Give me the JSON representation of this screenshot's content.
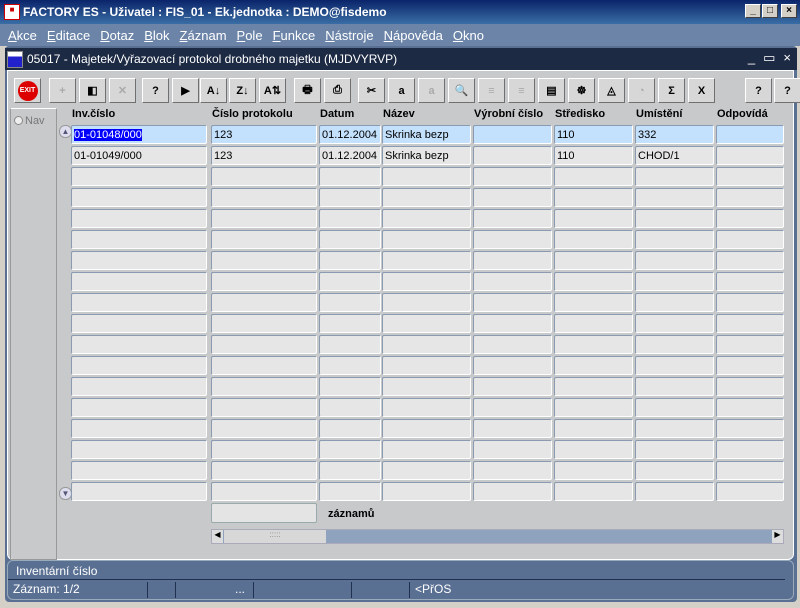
{
  "window": {
    "title": "FACTORY ES - Uživatel : FIS_01 - Ek.jednotka : DEMO@fisdemo",
    "controls": [
      "_",
      "□",
      "×"
    ]
  },
  "menu": [
    "Akce",
    "Editace",
    "Dotaz",
    "Blok",
    "Záznam",
    "Pole",
    "Funkce",
    "Nástroje",
    "Nápověda",
    "Okno"
  ],
  "form": {
    "title": "05017 - Majetek/Vyřazovací protokol drobného majetku (MJDVYRVP)",
    "controls": [
      "_",
      "▭",
      "×"
    ]
  },
  "toolbar": [
    {
      "name": "exit",
      "glyph": "EXIT",
      "enabled": true
    },
    {
      "name": "insert-record",
      "glyph": "+",
      "enabled": false
    },
    {
      "name": "save",
      "glyph": "◧",
      "enabled": true
    },
    {
      "name": "delete-record",
      "glyph": "✕",
      "enabled": false
    },
    {
      "name": "enter-query",
      "glyph": "?",
      "enabled": true
    },
    {
      "name": "execute-query",
      "glyph": "▶",
      "enabled": true
    },
    {
      "name": "sort-asc",
      "glyph": "A↓",
      "enabled": true
    },
    {
      "name": "sort-desc",
      "glyph": "Z↓",
      "enabled": true
    },
    {
      "name": "sort-multi",
      "glyph": "A⇅",
      "enabled": true
    },
    {
      "name": "print",
      "glyph": "🖶",
      "enabled": true
    },
    {
      "name": "print-setup",
      "glyph": "⎙",
      "enabled": true
    },
    {
      "name": "cut",
      "glyph": "✂",
      "enabled": true
    },
    {
      "name": "copy",
      "glyph": "a",
      "enabled": true
    },
    {
      "name": "paste",
      "glyph": "a",
      "enabled": false
    },
    {
      "name": "search",
      "glyph": "🔍",
      "enabled": true
    },
    {
      "name": "list-left",
      "glyph": "≡",
      "enabled": false
    },
    {
      "name": "list-right",
      "glyph": "≡",
      "enabled": false
    },
    {
      "name": "export",
      "glyph": "▤",
      "enabled": true
    },
    {
      "name": "wheel",
      "glyph": "☸",
      "enabled": true
    },
    {
      "name": "eye",
      "glyph": "◬",
      "enabled": true
    },
    {
      "name": "chart",
      "glyph": "◔",
      "enabled": false
    },
    {
      "name": "sum",
      "glyph": "Σ",
      "enabled": true
    },
    {
      "name": "excel",
      "glyph": "X",
      "enabled": true
    },
    {
      "name": "help",
      "glyph": "?",
      "enabled": true
    },
    {
      "name": "context-help",
      "glyph": "?",
      "enabled": true
    }
  ],
  "nav": {
    "label": "Nav"
  },
  "columns": [
    "Inv.číslo",
    "Číslo protokolu",
    "Datum",
    "Název",
    "Výrobní číslo",
    "Středisko",
    "Umístění",
    "Odpovídá"
  ],
  "rows": [
    [
      "01-01048/000",
      "123",
      "01.12.2004 I",
      "Skrinka bezp",
      "",
      "110",
      "332",
      ""
    ],
    [
      "01-01049/000",
      "123",
      "01.12.2004 I",
      "Skrinka bezp",
      "",
      "110",
      "CHOD/1",
      ""
    ]
  ],
  "empty_rows": 16,
  "count": {
    "value": "",
    "label": "záznamů"
  },
  "status": {
    "hint": "Inventární číslo",
    "record": "Záznam: 1/2",
    "ellipsis": "...",
    "mode": "<PřOS"
  }
}
